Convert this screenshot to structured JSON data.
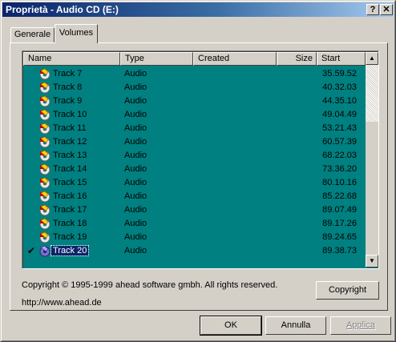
{
  "window": {
    "title": "Proprietà - Audio CD (E:)",
    "help_label": "?",
    "close_label": "✕"
  },
  "tabs": [
    {
      "label": "Generale"
    },
    {
      "label": "Volumes"
    }
  ],
  "list": {
    "columns": [
      {
        "label": "Name"
      },
      {
        "label": "Type"
      },
      {
        "label": "Created"
      },
      {
        "label": "Size"
      },
      {
        "label": "Start"
      }
    ],
    "rows": [
      {
        "name": "Track 7",
        "type": "Audio",
        "start": "35.59.52"
      },
      {
        "name": "Track 8",
        "type": "Audio",
        "start": "40.32.03"
      },
      {
        "name": "Track 9",
        "type": "Audio",
        "start": "44.35.10"
      },
      {
        "name": "Track 10",
        "type": "Audio",
        "start": "49.04.49"
      },
      {
        "name": "Track 11",
        "type": "Audio",
        "start": "53.21.43"
      },
      {
        "name": "Track 12",
        "type": "Audio",
        "start": "60.57.39"
      },
      {
        "name": "Track 13",
        "type": "Audio",
        "start": "68.22.03"
      },
      {
        "name": "Track 14",
        "type": "Audio",
        "start": "73.36.20"
      },
      {
        "name": "Track 15",
        "type": "Audio",
        "start": "80.10.16"
      },
      {
        "name": "Track 16",
        "type": "Audio",
        "start": "85.22.68"
      },
      {
        "name": "Track 17",
        "type": "Audio",
        "start": "89.07.49"
      },
      {
        "name": "Track 18",
        "type": "Audio",
        "start": "89.17.26"
      },
      {
        "name": "Track 19",
        "type": "Audio",
        "start": "89.24.65"
      },
      {
        "name": "Track 20",
        "type": "Audio",
        "start": "89.38.73",
        "selected": true,
        "checked": true
      }
    ],
    "check_mark": "✔",
    "scroll_up": "▲",
    "scroll_down": "▼"
  },
  "footer": {
    "copyright_text": "Copyright © 1995-1999 ahead software gmbh. All rights reserved.",
    "url_text": "http://www.ahead.de",
    "copyright_button": "Copyright"
  },
  "buttons": {
    "ok": "OK",
    "cancel": "Annulla",
    "apply": "Applica"
  }
}
